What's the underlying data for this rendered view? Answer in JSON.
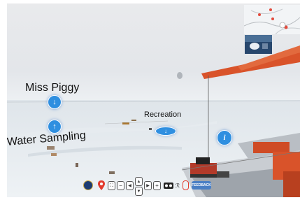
{
  "hotspots": {
    "miss_piggy": {
      "label": "Miss Piggy",
      "icon": "arrow-down-icon",
      "glyph": "↓"
    },
    "water_sampling": {
      "label": "Water Sampling",
      "icon": "arrow-up-icon",
      "glyph": "↑"
    },
    "recreation": {
      "label": "Recreation",
      "icon": "arrow-down-icon",
      "glyph": "↓"
    },
    "info": {
      "icon": "info-icon",
      "glyph": "i"
    }
  },
  "toolbar": {
    "feedback_label": "FEEDBACK",
    "zoom_out": "−",
    "zoom_in": "+",
    "left": "◀",
    "right": "▶",
    "up": "▲",
    "down": "▼"
  },
  "colors": {
    "hotspot": "#2f8fe0",
    "ship": "#d9532a",
    "feedback": "#4a7fc4"
  }
}
